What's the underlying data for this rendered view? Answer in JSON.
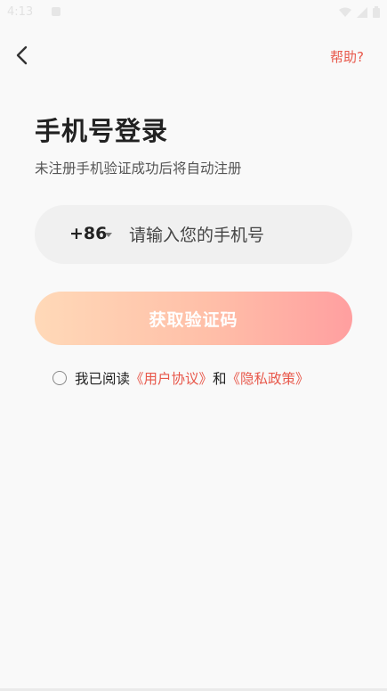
{
  "status_bar": {
    "time": "4:13"
  },
  "header": {
    "help_label": "帮助?"
  },
  "main": {
    "title": "手机号登录",
    "subtitle": "未注册手机验证成功后将自动注册",
    "country_code": "+86",
    "phone_placeholder": "请输入您的手机号",
    "get_code_label": "获取验证码"
  },
  "agreement": {
    "prefix": "我已阅读",
    "user_agreement": "《用户协议》",
    "and": "和",
    "privacy_policy": "《隐私政策》"
  },
  "colors": {
    "accent": "#e8584b",
    "button_gradient_start": "#ffd9b8",
    "button_gradient_end": "#ff9fa0",
    "background": "#f9f9f9"
  },
  "icons": [
    "back-arrow-icon",
    "dropdown-caret-icon",
    "wifi-icon",
    "signal-icon",
    "battery-icon"
  ]
}
